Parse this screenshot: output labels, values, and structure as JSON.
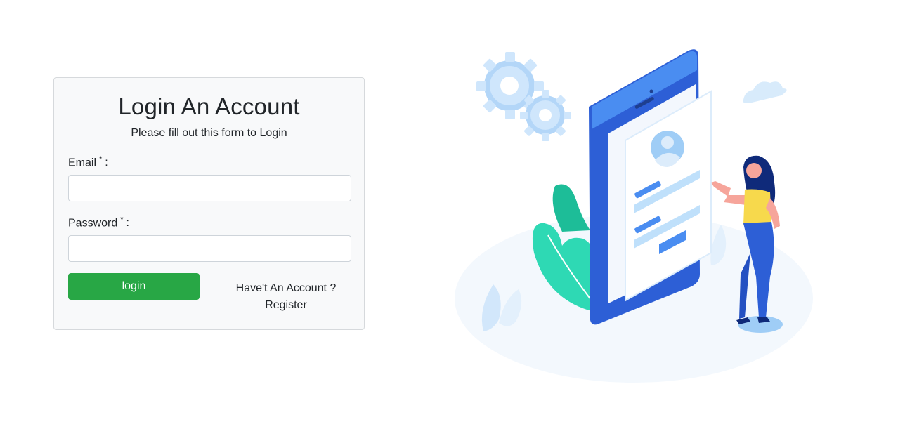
{
  "login_card": {
    "title": "Login An Account",
    "subtitle": "Please fill out this form to Login",
    "email_label": "Email",
    "password_label": "Password",
    "required_marker": "*",
    "label_colon": ":",
    "email_value": "",
    "password_value": "",
    "login_button": "login",
    "account_question": "Have't An Account ?",
    "register_link": "Register"
  },
  "colors": {
    "primary_button": "#28a745",
    "card_background": "#f8f9fa",
    "phone_blue": "#2d5fd6",
    "accent_light_blue": "#bfe0fb",
    "plant_teal": "#2ed9b4"
  },
  "illustration": {
    "icons": [
      "gear-icon",
      "cloud-icon",
      "phone-illustration",
      "avatar-icon",
      "plant-icon",
      "woman-figure"
    ]
  }
}
